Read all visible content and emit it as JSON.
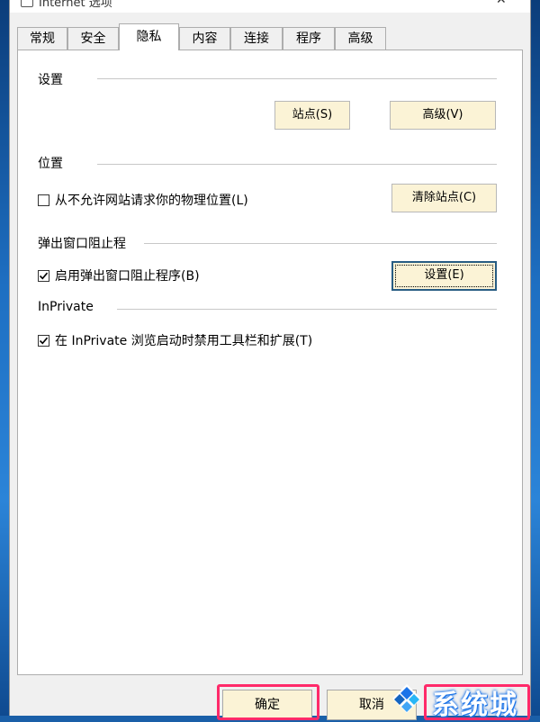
{
  "window": {
    "title": "Internet 选项",
    "close_glyph": "✕"
  },
  "tabs": [
    {
      "label": "常规",
      "active": false
    },
    {
      "label": "安全",
      "active": false
    },
    {
      "label": "隐私",
      "active": true
    },
    {
      "label": "内容",
      "active": false
    },
    {
      "label": "连接",
      "active": false
    },
    {
      "label": "程序",
      "active": false
    },
    {
      "label": "高级",
      "active": false
    }
  ],
  "settings_group": {
    "label": "设置",
    "sites_button": "站点(S)",
    "advanced_button": "高级(V)"
  },
  "location_group": {
    "label": "位置",
    "never_allow_checkbox": {
      "label": "从不允许网站请求你的物理位置(L)",
      "checked": false
    },
    "clear_sites_button": "清除站点(C)"
  },
  "popup_group": {
    "label": "弹出窗口阻止程",
    "enable_checkbox": {
      "label": "启用弹出窗口阻止程序(B)",
      "checked": true
    },
    "settings_button": "设置(E)"
  },
  "inprivate_group": {
    "label": "InPrivate",
    "disable_toolbars_checkbox": {
      "label": "在 InPrivate 浏览启动时禁用工具栏和扩展(T)",
      "checked": true
    }
  },
  "footer": {
    "ok_button": "确定",
    "cancel_button": "取消"
  },
  "watermark": {
    "text": "系统城",
    "logo_icon": "windows-logo-icon"
  },
  "colors": {
    "button_face": "#fbf3d6",
    "focus_border": "#285d83",
    "highlight_box": "#ff2a6a",
    "desktop": "#1a5fa8"
  }
}
